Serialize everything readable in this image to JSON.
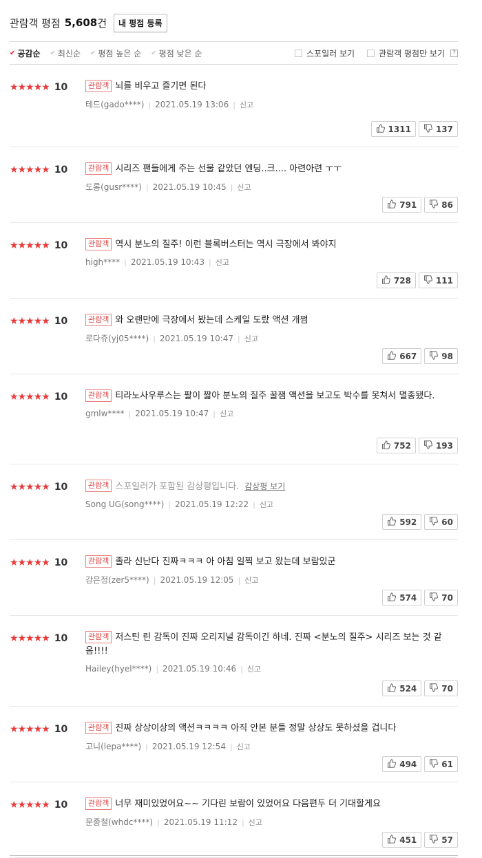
{
  "header": {
    "title": "관람객 평점",
    "count": "5,608",
    "count_unit": "건",
    "my_rating_button": "내 평점 등록"
  },
  "filters": {
    "sorts": [
      {
        "label": "공감순",
        "active": true
      },
      {
        "label": "최신순",
        "active": false
      },
      {
        "label": "평점 높은 순",
        "active": false
      },
      {
        "label": "평점 낮은 순",
        "active": false
      }
    ],
    "options": [
      {
        "label": "스포일러 보기",
        "checked": false
      },
      {
        "label": "관람객 평점만 보기",
        "checked": false
      }
    ],
    "help_label": "?"
  },
  "badge_label": "관람객",
  "report_label": "신고",
  "spoiler_link_label": "감상평 보기",
  "reviews": [
    {
      "score": "10",
      "text": "뇌를 비우고 즐기면 된다",
      "spoiler": false,
      "user": "테드(gado****)",
      "date": "2021.05.19 13:06",
      "likes": "1311",
      "dislikes": "137"
    },
    {
      "score": "10",
      "text": "시리즈 팬들에게 주는 선물 같았던 엔딩..크.... 아련아련 ㅜㅜ",
      "spoiler": false,
      "user": "도롱(gusr****)",
      "date": "2021.05.19 10:45",
      "likes": "791",
      "dislikes": "86"
    },
    {
      "score": "10",
      "text": "역시 분노의 질주! 이런 블록버스터는 역시 극장에서 봐야지",
      "spoiler": false,
      "user": "high****",
      "date": "2021.05.19 10:43",
      "likes": "728",
      "dislikes": "111"
    },
    {
      "score": "10",
      "text": "와 오랜만에 극장에서 봤는데 스케일 도랐 액션 개쩜",
      "spoiler": false,
      "user": "로다쥬(yj05****)",
      "date": "2021.05.19 10:47",
      "likes": "667",
      "dislikes": "98"
    },
    {
      "score": "10",
      "text": "티라노사우루스는 팔이 짧아 분노의 질주 꿀잼 액션을 보고도 박수를 못쳐서 멸종됐다.",
      "spoiler": false,
      "user": "gmlw****",
      "date": "2021.05.19 10:47",
      "likes": "752",
      "dislikes": "193"
    },
    {
      "score": "10",
      "text": "스포일러가 포함된 감상평입니다.",
      "spoiler": true,
      "user": "Song UG(song****)",
      "date": "2021.05.19 12:22",
      "likes": "592",
      "dislikes": "60"
    },
    {
      "score": "10",
      "text": "졸라 신난다 진짜ㅋㅋㅋ 아 아침 일찍 보고 왔는데 보람있군",
      "spoiler": false,
      "user": "강은정(zer5****)",
      "date": "2021.05.19 12:05",
      "likes": "574",
      "dislikes": "70"
    },
    {
      "score": "10",
      "text": "저스틴 린 감독이 진짜 오리지널 감독이긴 하네. 진짜 <분노의 질주> 시리즈 보는 것 같음!!!!",
      "spoiler": false,
      "user": "Hailey(hyel****)",
      "date": "2021.05.19 10:46",
      "likes": "524",
      "dislikes": "70"
    },
    {
      "score": "10",
      "text": "진짜 상상이상의 액션ㅋㅋㅋㅋ 아직 안본 분들 정말 상상도 못하셨을 겁니다",
      "spoiler": false,
      "user": "고니(lepa****)",
      "date": "2021.05.19 12:54",
      "likes": "494",
      "dislikes": "61"
    },
    {
      "score": "10",
      "text": "너무 재미있었어요~~ 기다린 보람이 있었어요 다음편두 더 기대할게요",
      "spoiler": false,
      "user": "문종철(whdc****)",
      "date": "2021.05.19 11:12",
      "likes": "451",
      "dislikes": "57"
    }
  ],
  "colors": {
    "star": "#e83a3a",
    "badge_border": "#e58080",
    "badge_text": "#e04040",
    "active_check": "#e02020"
  }
}
